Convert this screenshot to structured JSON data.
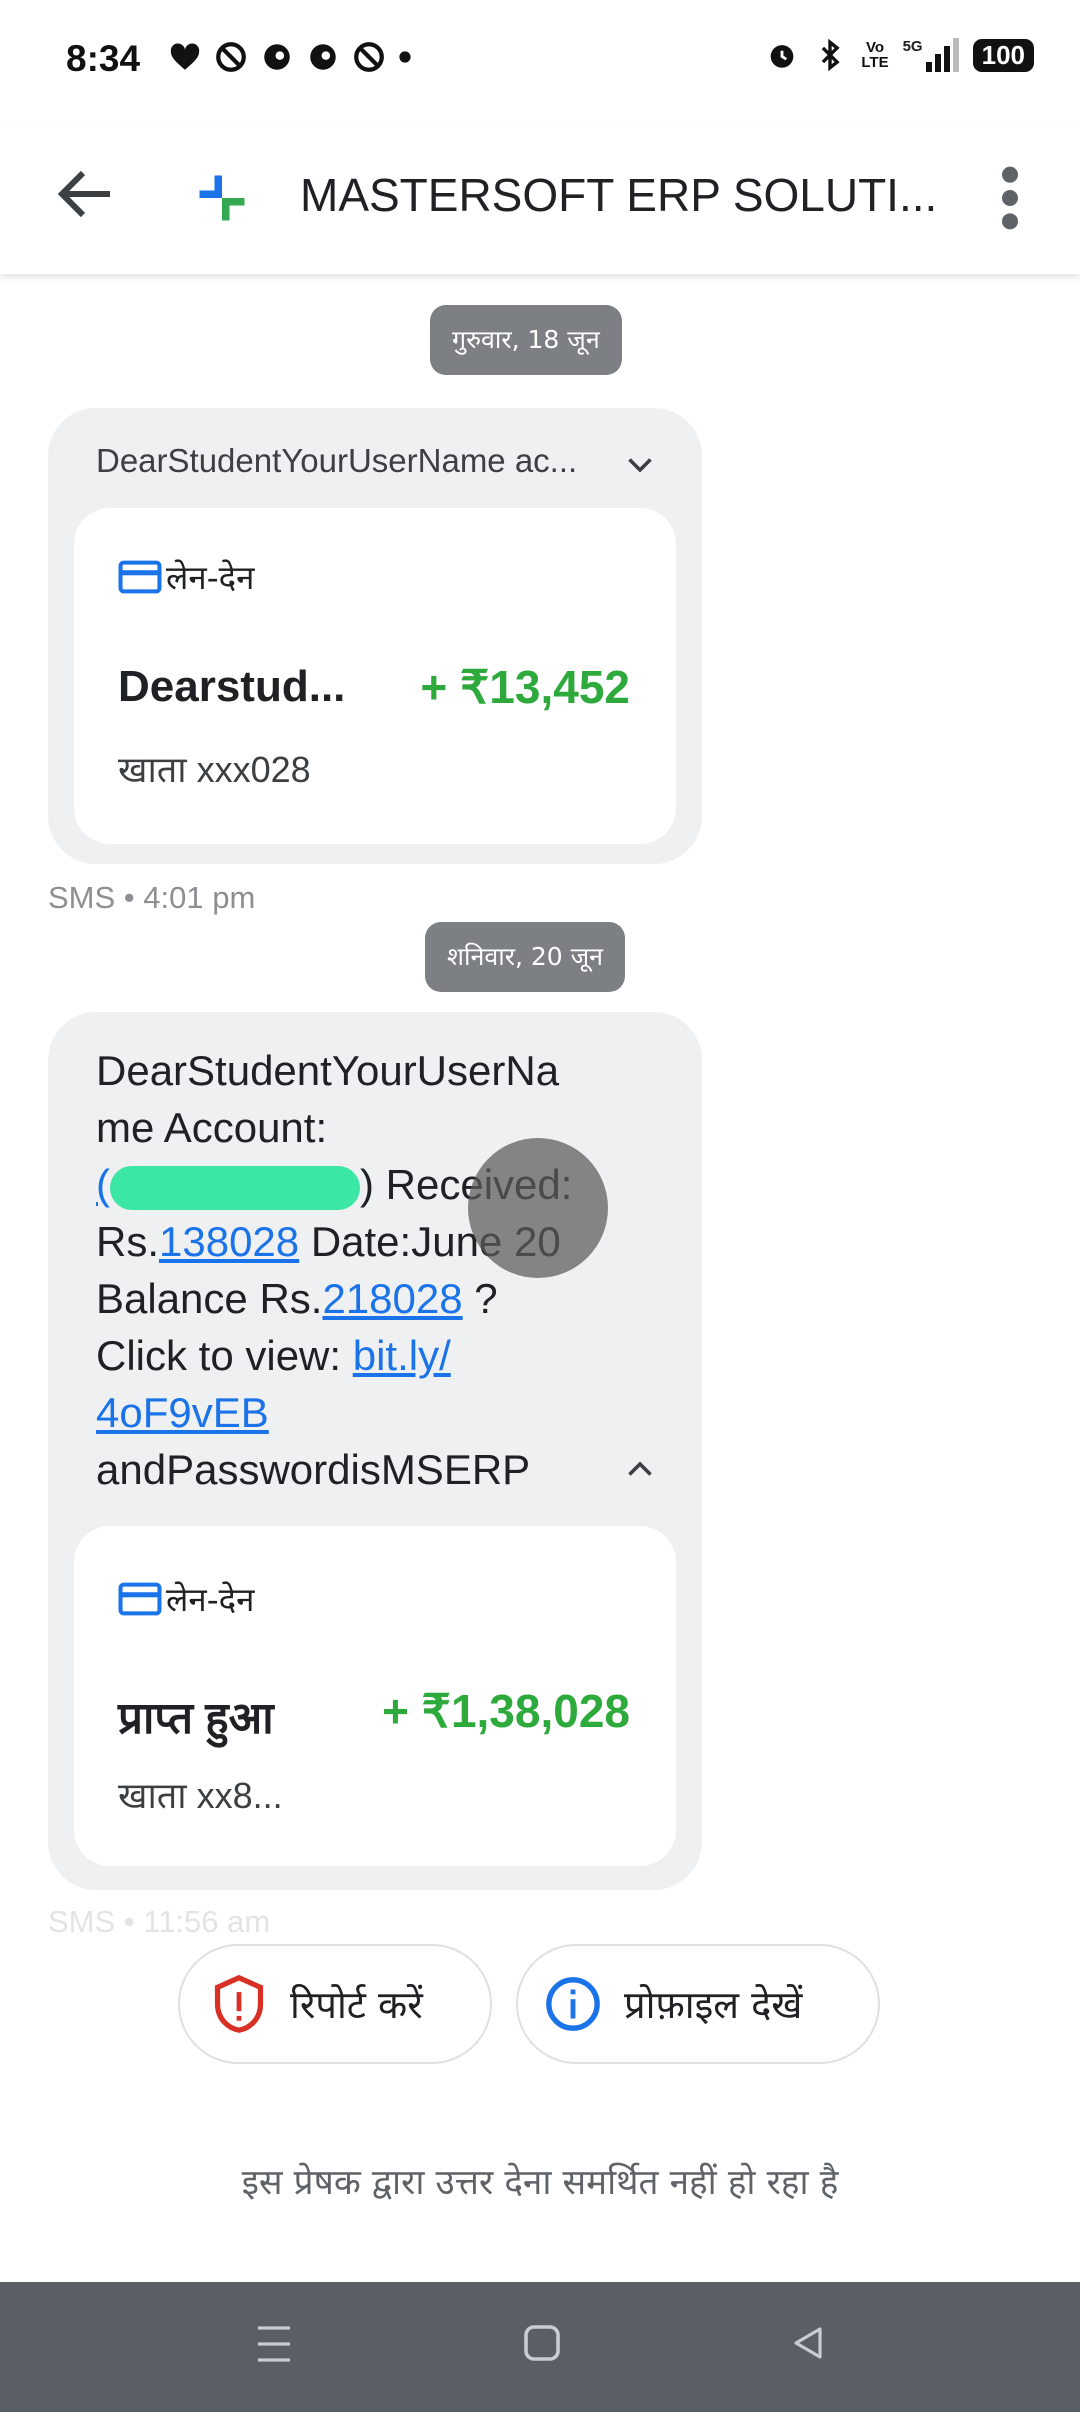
{
  "status_bar": {
    "time": "8:34",
    "battery": "100",
    "network": "5G",
    "volte_top": "Vo",
    "volte_bottom": "LTE"
  },
  "header": {
    "title": "MASTERSOFT ERP SOLUTI..."
  },
  "conversation": {
    "date_chip_1": "गुरुवार, 18 जून",
    "message_1": {
      "collapsed_preview": "DearStudentYourUserName ac...",
      "card_label": "लेन-देन",
      "txn_name": "Dearstud...",
      "txn_amount": "+ ₹13,452",
      "account": "खाता xxx028",
      "meta": "SMS • 4:01 pm"
    },
    "date_chip_2": "शनिवार, 20 जून",
    "message_2": {
      "line1": "DearStudentYourUserNa",
      "line2": "me Account:",
      "line3_open": "(",
      "line3_close": ") Received:",
      "line4_prefix": "Rs.",
      "line4_link": "138028",
      "line4_suffix": " Date:June 20",
      "line5_prefix": "Balance Rs.",
      "line5_link": "218028",
      "line5_suffix": " ?",
      "line6": "Click to view: ",
      "line6_link": "bit.ly/",
      "line7_link": "4oF9vEB",
      "line8": "andPasswordisMSERP",
      "card_label": "लेन-देन",
      "txn_name": "प्राप्त हुआ",
      "txn_amount": "+ ₹1,38,028",
      "account": "खाता xx8...",
      "meta": "SMS • 11:56 am"
    }
  },
  "actions": {
    "report_label": "रिपोर्ट करें",
    "profile_label": "प्रोफ़ाइल देखें"
  },
  "footer": {
    "note": "इस प्रेषक द्वारा उत्तर देना समर्थित नहीं हो रहा है"
  },
  "colors": {
    "amount_green": "#2eaa3c",
    "link_blue": "#1a73e8",
    "report_red": "#d93025",
    "info_blue": "#1a73e8",
    "chip_gray": "#7c7f83",
    "navbar": "#5a5e65"
  }
}
